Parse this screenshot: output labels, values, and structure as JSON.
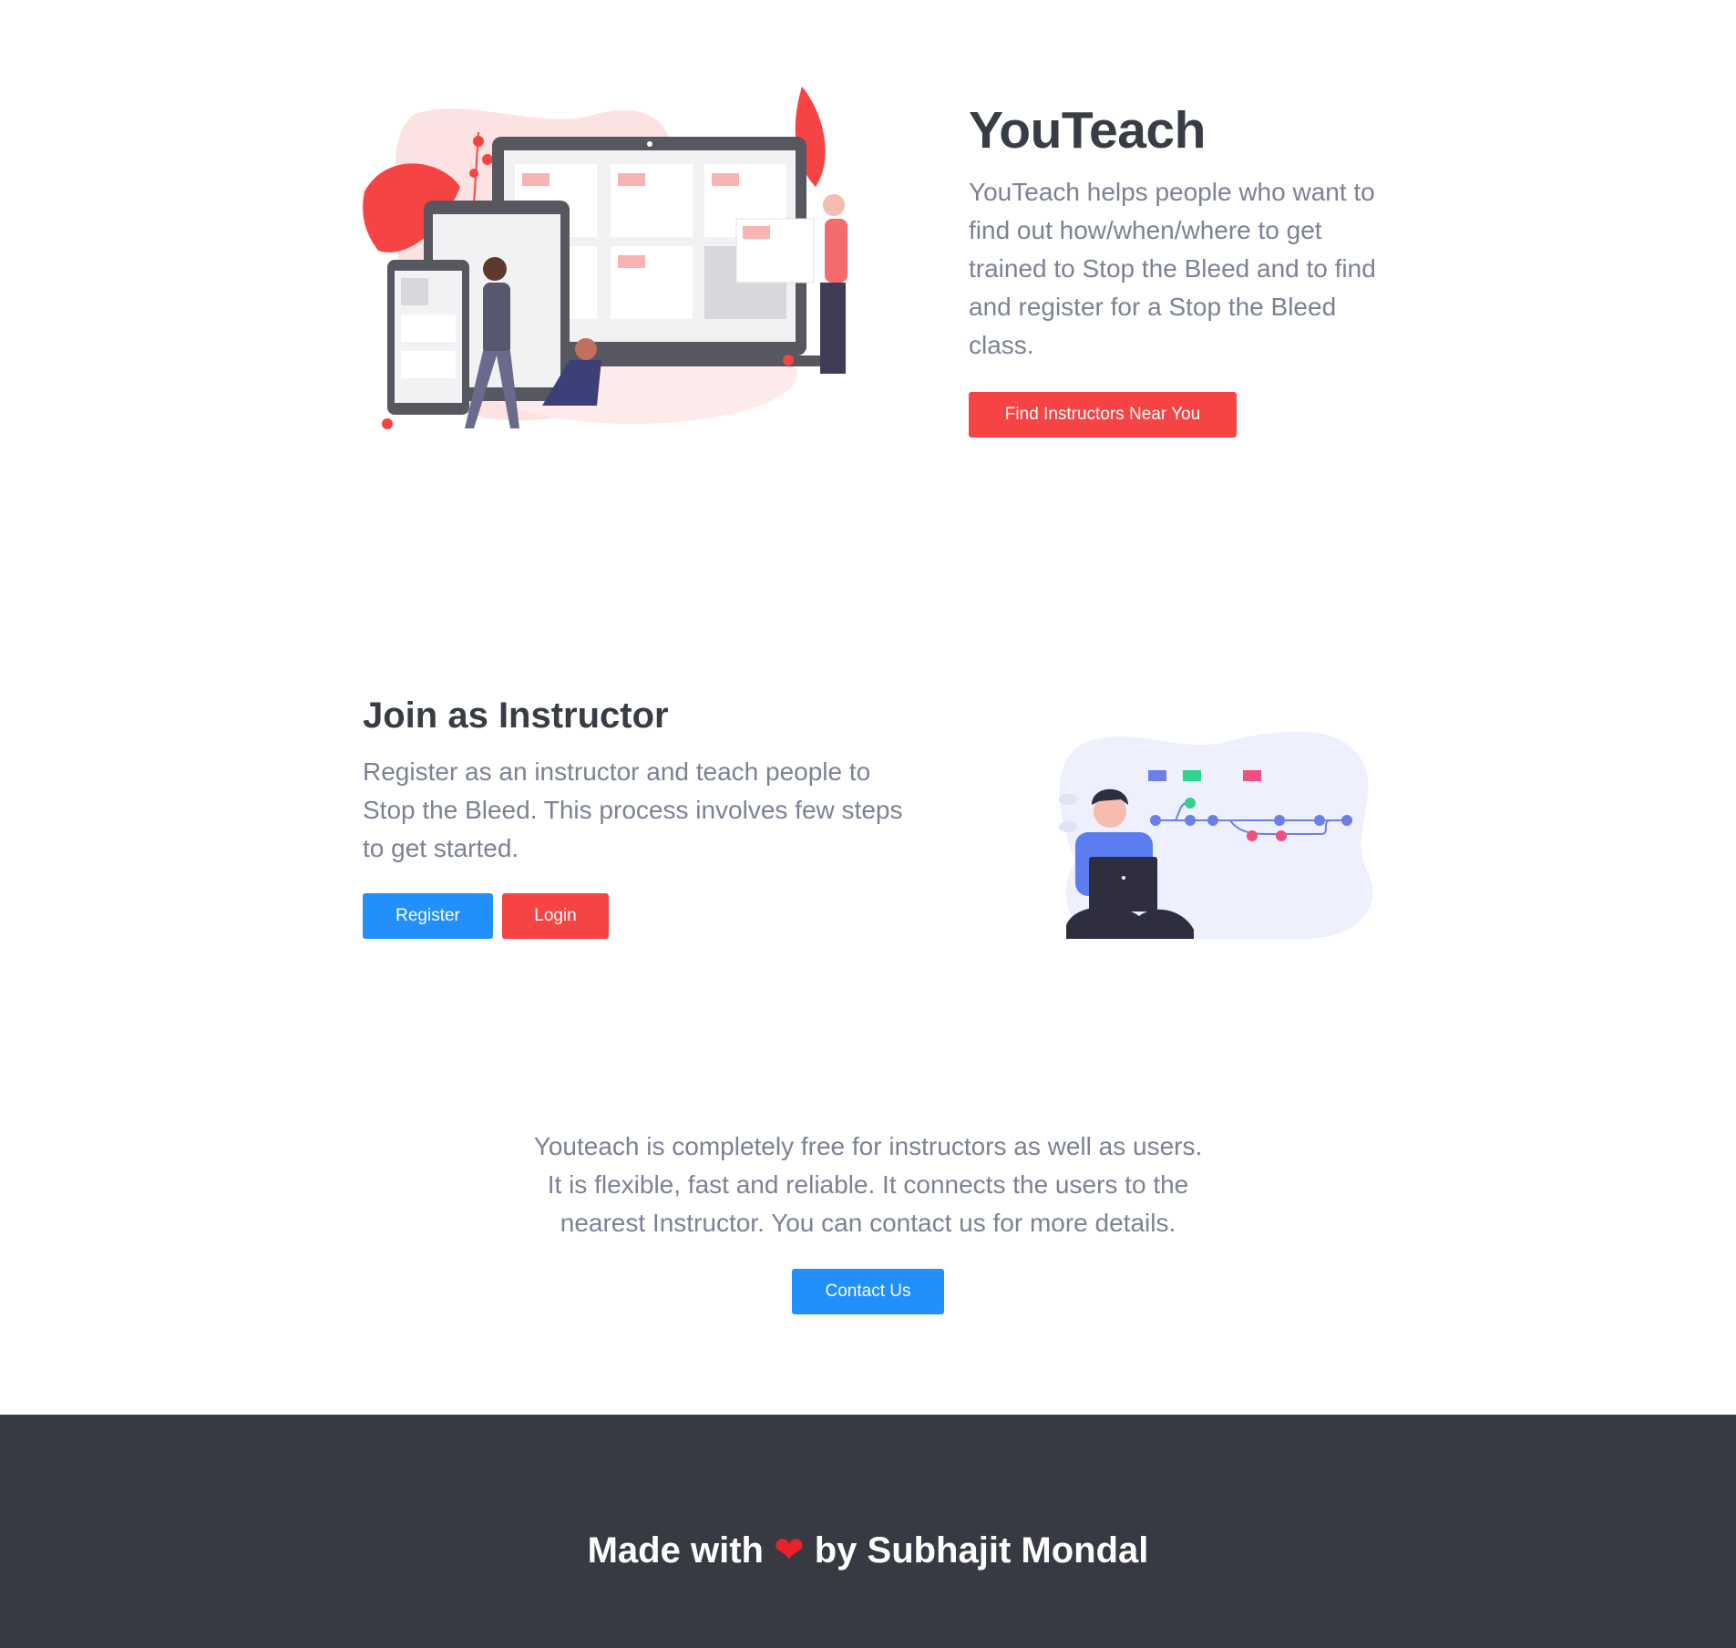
{
  "hero": {
    "title": "YouTeach",
    "description": "YouTeach helps people who want to find out how/when/where to get trained to Stop the Bleed and to find and register for a Stop the Bleed class.",
    "cta_label": "Find Instructors Near You"
  },
  "instructor": {
    "title": "Join as Instructor",
    "description": "Register as an instructor and teach people to Stop the Bleed. This process involves few steps to get started.",
    "register_label": "Register",
    "login_label": "Login"
  },
  "about": {
    "line1": "Youteach is completely free for instructors as well as users.",
    "line2": "It is flexible, fast and reliable. It connects the users to the",
    "line3": "nearest Instructor. You can contact us for more details.",
    "contact_label": "Contact Us"
  },
  "footer": {
    "prefix": "Made with",
    "heart": "❤",
    "suffix": "by Subhajit Mondal"
  },
  "colors": {
    "accent_red": "#f64444",
    "accent_blue": "#2190fb",
    "footer_bg": "#373a42"
  }
}
